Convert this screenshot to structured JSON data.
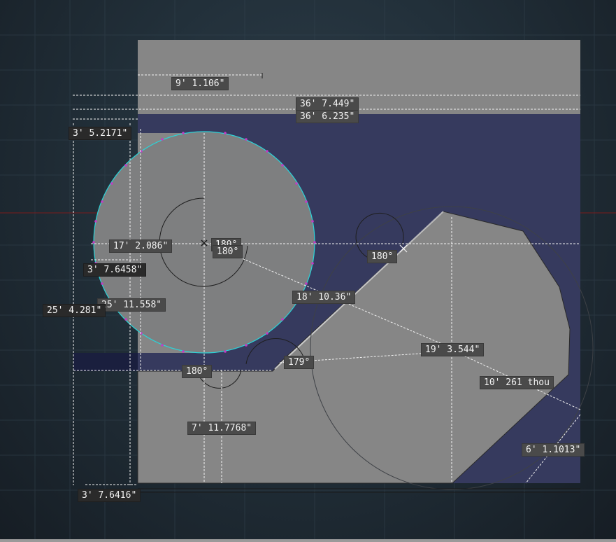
{
  "colors": {
    "sheet": "#868686",
    "cut_region": "#363a5e",
    "circle_fill": "#7e7f80",
    "circle_outline": "#2ad4d8",
    "vertex": "#c23cc4",
    "gridline_red": "#7a1c1c",
    "label_bg": "#4a4a4a"
  },
  "dimensions": {
    "top_width": "9' 1.106\"",
    "overall_width": "36' 7.449\"",
    "inner_width": "36' 6.235\"",
    "left_offset_top": "3' 5.2171\"",
    "circle_diameter": "17' 2.086\"",
    "angle_center_a": "180°",
    "angle_center_b": "180°",
    "angle_notch": "180°",
    "left_offset_mid": "3' 7.6458\"",
    "diagonal_length": "18' 10.36\"",
    "overall_height": "25' 4.281\"",
    "circle_height": "25' 11.558\"",
    "long_diagonal": "19' 3.544\"",
    "angle_bottom": "180°",
    "angle_join": "179°",
    "radius_right": "10' 261 thou",
    "bottom_depth": "7' 11.7768\"",
    "right_corner": "6' 1.1013\"",
    "left_offset_bottom": "3' 7.6416\""
  }
}
